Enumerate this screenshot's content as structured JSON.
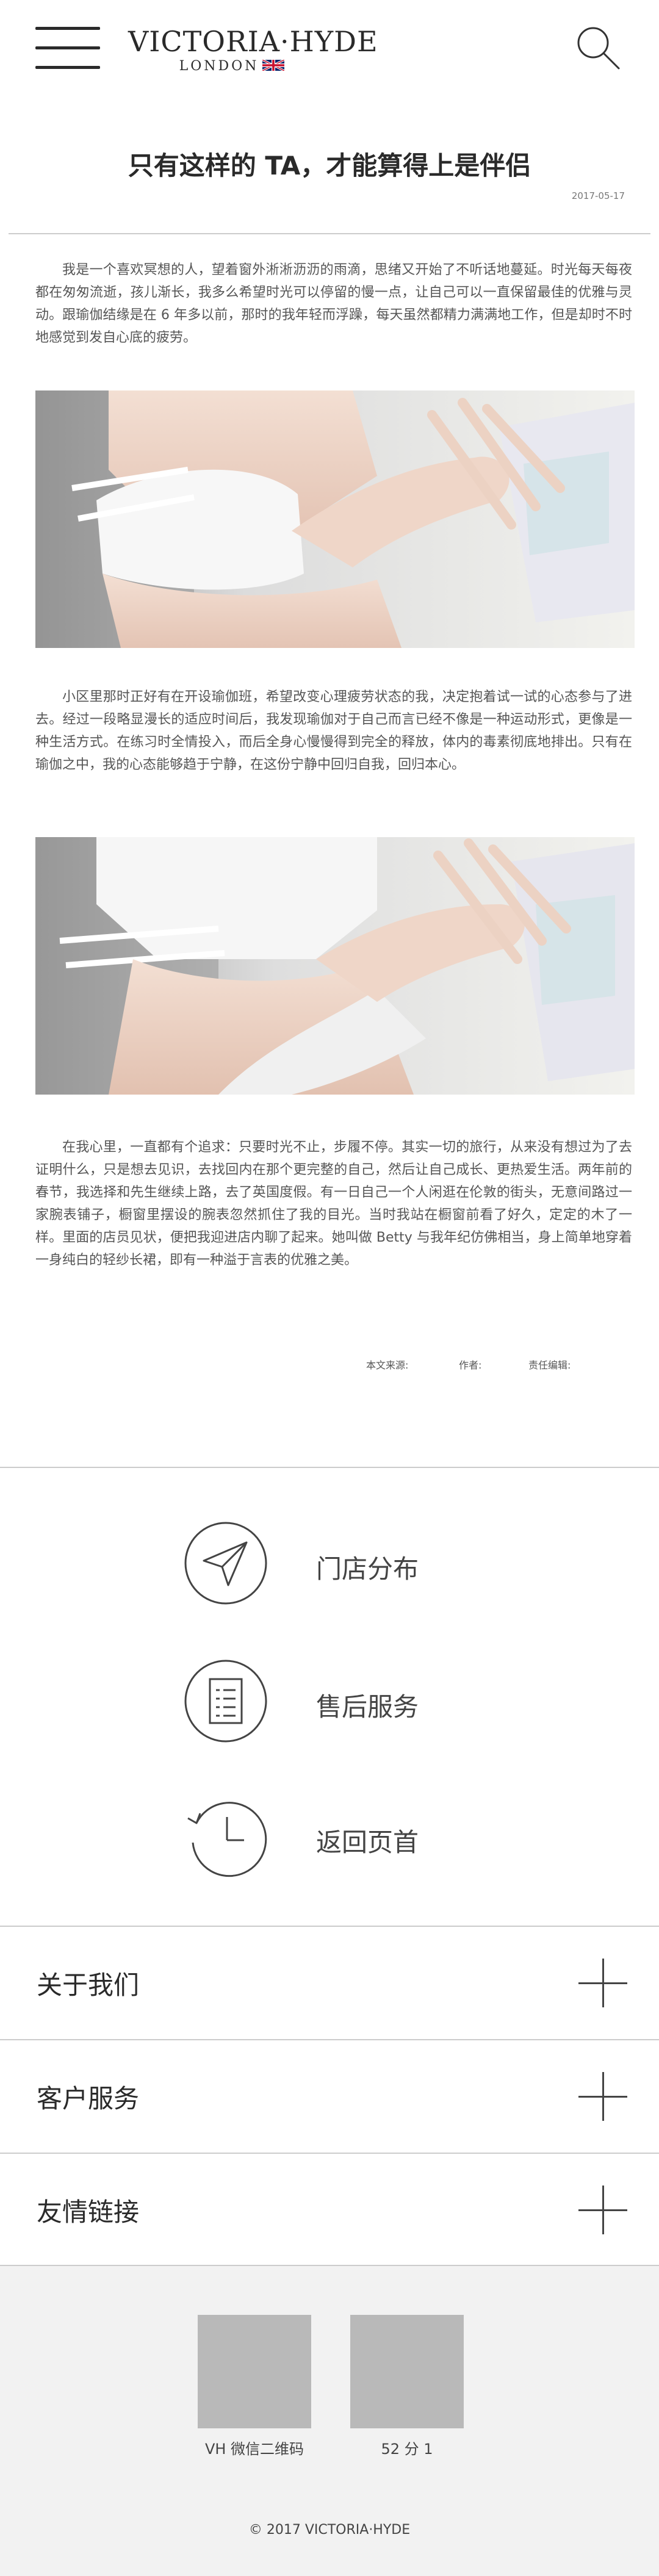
{
  "header": {
    "brand": "VICTORIA·HYDE",
    "sub": "LONDON",
    "menu_icon": "hamburger-menu-icon",
    "search_icon": "search-icon"
  },
  "article": {
    "title": "只有这样的 TA，才能算得上是伴侣",
    "date": "2017-05-17",
    "paragraphs": [
      "我是一个喜欢冥想的人，望着窗外淅淅沥沥的雨滴，思绪又开始了不听话地蔓延。时光每天每夜都在匆匆流逝，孩儿渐长，我多么希望时光可以停留的慢一点，让自己可以一直保留最佳的优雅与灵动。跟瑜伽结缘是在 6 年多以前，那时的我年轻而浮躁，每天虽然都精力满满地工作，但是却时不时地感觉到发自心底的疲劳。",
      "小区里那时正好有在开设瑜伽班，希望改变心理疲劳状态的我，决定抱着试一试的心态参与了进去。经过一段略显漫长的适应时间后，我发现瑜伽对于自己而言已经不像是一种运动形式，更像是一种生活方式。在练习时全情投入，而后全身心慢慢得到完全的释放，体内的毒素彻底地排出。只有在瑜伽之中，我的心态能够趋于宁静，在这份宁静中回归自我，回归本心。",
      "在我心里，一直都有个追求：只要时光不止，步履不停。其实一切的旅行，从来没有想过为了去证明什么，只是想去见识，去找回内在那个更完整的自己，然后让自己成长、更热爱生活。两年前的春节，我选择和先生继续上路，去了英国度假。有一日自己一个人闲逛在伦敦的街头，无意间路过一家腕表铺子，橱窗里摆设的腕表忽然抓住了我的目光。当时我站在橱窗前看了好久，定定的木了一样。里面的店员见状，便把我迎进店内聊了起来。她叫做 Betty 与我年纪仿佛相当，身上简单地穿着一身纯白的轻纱长裙，即有一种溢于言表的优雅之美。"
    ],
    "source_label": "本文来源:",
    "author_label": "作者:",
    "editor_label": "责任编辑:"
  },
  "quick_links": [
    {
      "label": "门店分布",
      "icon": "send-arrow-icon"
    },
    {
      "label": "售后服务",
      "icon": "document-list-icon"
    },
    {
      "label": "返回页首",
      "icon": "clock-back-icon"
    }
  ],
  "accordion": [
    {
      "label": "关于我们"
    },
    {
      "label": "客户服务"
    },
    {
      "label": "友情链接"
    }
  ],
  "footer": {
    "qr_labels": [
      "VH 微信二维码",
      "52 分 1"
    ],
    "copyright": "© 2017 VICTORIA·HYDE"
  },
  "colors": {
    "text": "#333333",
    "divider": "#cccccc",
    "footer_bg": "#f2f2f2",
    "qr_placeholder": "#b9b9b9"
  }
}
